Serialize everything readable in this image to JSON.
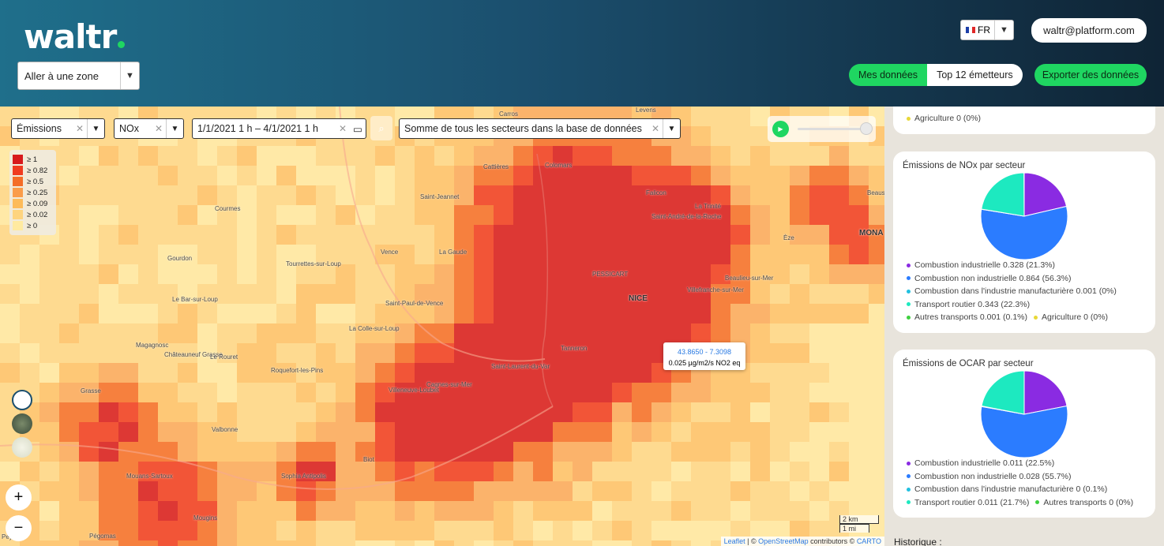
{
  "header": {
    "logo": "waltr",
    "zone_select": "Aller à une zone",
    "lang": "FR",
    "user": "waltr@platform.com",
    "tab_mine": "Mes données",
    "tab_top": "Top 12 émetteurs",
    "export": "Exporter des données"
  },
  "filters": {
    "variable": "Émissions",
    "pollutant": "NOx",
    "date": "1/1/2021 1 h – 4/1/2021 1 h",
    "sector": "Somme de tous les secteurs dans la base de données"
  },
  "legend": [
    "≥ 1",
    "≥ 0.82",
    "≥ 0.5",
    "≥ 0.25",
    "≥ 0.09",
    "≥ 0.02",
    "≥ 0"
  ],
  "legend_colors": [
    "#d7191c",
    "#f03b20",
    "#f46d28",
    "#fa9c4a",
    "#fdbb5a",
    "#fed47f",
    "#ffeaa0"
  ],
  "map_labels": [
    "Carros",
    "Levens",
    "Cattières",
    "Colomars",
    "Saint-Jeannet",
    "Falicon",
    "La Trinité",
    "Saint-André-de-la-Roche",
    "Courmes",
    "Gourdon",
    "Vence",
    "La Gaude",
    "Tourrettes-sur-Loup",
    "Èze",
    "MONA",
    "Beaus",
    "Le Bar-sur-Loup",
    "Saint-Paul-de-Vence",
    "NICE",
    "Villefranche-sur-Mer",
    "Beaulieu-sur-Mer",
    "La Colle-sur-Loup",
    "Magagnosc",
    "Châteauneuf Grasse",
    "Le Rouret",
    "Roquefort-les-Pins",
    "Saint-Laurent-du-Var",
    "Villeneuve-Loubet",
    "Cagnes-sur-Mer",
    "Grasse",
    "Valbonne",
    "Biot",
    "Mouans-Sartoux",
    "Mougins",
    "Pégomas",
    "Sophia Antipolis",
    "PESSICART",
    "Tanneron",
    "Peym"
  ],
  "popup": {
    "coords": "43.8650 - 7.3098",
    "value": "0.025 µg/m2/s NO2 eq"
  },
  "scale": {
    "km": "2 km",
    "mi": "1 mi"
  },
  "attribution": {
    "leaflet": "Leaflet",
    "sep": " | © ",
    "osm": "OpenStreetMap",
    "contrib": " contributors © ",
    "carto": "CARTO"
  },
  "zoom": {
    "in": "+",
    "out": "−"
  },
  "sidebar": {
    "top_card": {
      "item": "Agriculture 0 (0%)"
    },
    "nox_card": {
      "title": "Émissions de NOx par secteur",
      "items": [
        "Combustion industrielle 0.328 (21.3%)",
        "Combustion non industrielle 0.864 (56.3%)",
        "Combustion dans l'industrie manufacturière 0.001 (0%)",
        "Transport routier 0.343 (22.3%)",
        "Autres transports 0.001 (0.1%)",
        "Agriculture 0 (0%)"
      ]
    },
    "ocar_card": {
      "title": "Émissions de OCAR par secteur",
      "items": [
        "Combustion industrielle 0.011 (22.5%)",
        "Combustion non industrielle 0.028 (55.7%)",
        "Combustion dans l'industrie manufacturière 0 (0.1%)",
        "Transport routier 0.011 (21.7%)",
        "Autres transports 0 (0%)"
      ]
    },
    "history": "Historique :"
  },
  "chart_data": [
    {
      "type": "pie",
      "title": "Émissions de NOx par secteur",
      "categories": [
        "Combustion industrielle",
        "Combustion non industrielle",
        "Combustion dans l'industrie manufacturière",
        "Transport routier",
        "Autres transports",
        "Agriculture"
      ],
      "values": [
        0.328,
        0.864,
        0.001,
        0.343,
        0.001,
        0
      ],
      "colors": [
        "#8a2be2",
        "#2b7cff",
        "#22c0e0",
        "#1de9c0",
        "#40d040",
        "#e8d838"
      ]
    },
    {
      "type": "pie",
      "title": "Émissions de OCAR par secteur",
      "categories": [
        "Combustion industrielle",
        "Combustion non industrielle",
        "Combustion dans l'industrie manufacturière",
        "Transport routier",
        "Autres transports"
      ],
      "values": [
        0.011,
        0.028,
        0.0001,
        0.011,
        0
      ],
      "colors": [
        "#8a2be2",
        "#2b7cff",
        "#22c0e0",
        "#1de9c0",
        "#40d040"
      ]
    }
  ]
}
